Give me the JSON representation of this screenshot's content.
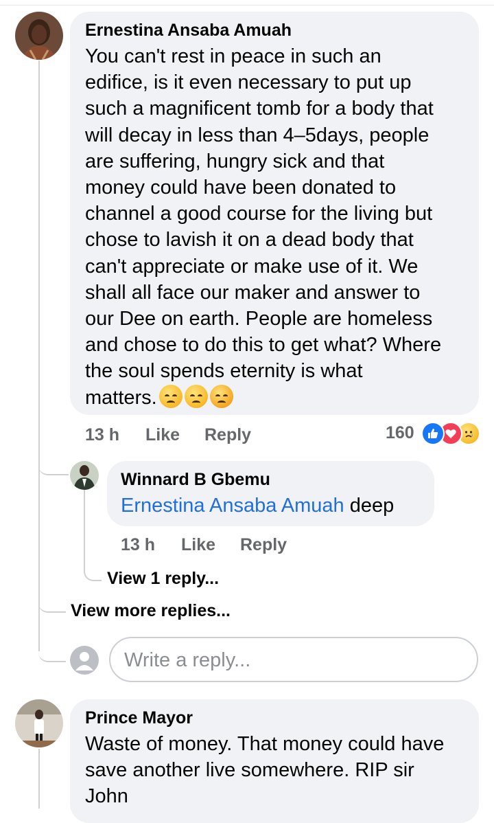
{
  "comments": [
    {
      "author": "Ernestina Ansaba Amuah",
      "lines": [
        "You can't rest in peace in such an",
        "edifice, is it even necessary to put up",
        "such a magnificent tomb for a body that",
        "will decay in less than 4–5days, people",
        "are suffering, hungry sick and that",
        "money could have been donated to",
        "channel a good course for the living but",
        "chose to lavish it on a dead body that",
        "can't appreciate or make use of it. We",
        "shall all face our maker and answer to",
        "our Dee on earth. People are homeless",
        "and chose to do this to get what? Where",
        "the soul spends eternity is what",
        "matters."
      ],
      "emoji_names": [
        "pensive-face-emoji",
        "pensive-face-emoji",
        "persevering-face-emoji"
      ],
      "time": "13 h",
      "like_label": "Like",
      "reply_label": "Reply",
      "reaction_count": "160",
      "reaction_icons": [
        "like-reaction-icon",
        "love-reaction-icon",
        "sad-reaction-icon"
      ]
    },
    {
      "author": "Winnard B Gbemu",
      "mention": "Ernestina Ansaba Amuah",
      "text": " deep",
      "time": "13 h",
      "like_label": "Like",
      "reply_label": "Reply",
      "view_replies": "View 1 reply..."
    },
    {
      "author": "Prince Mayor",
      "lines": [
        "Waste of money. That money could have",
        "save another live somewhere. RIP sir",
        "John"
      ]
    }
  ],
  "view_more_replies": "View more replies...",
  "reply_box": {
    "placeholder": "Write a reply..."
  },
  "colors": {
    "bubble": "#f0f2f5",
    "link": "#216fdb",
    "meta": "#65676b",
    "like": "#1877f2",
    "love": "#f33e58",
    "thread_line": "#ced0d4"
  }
}
